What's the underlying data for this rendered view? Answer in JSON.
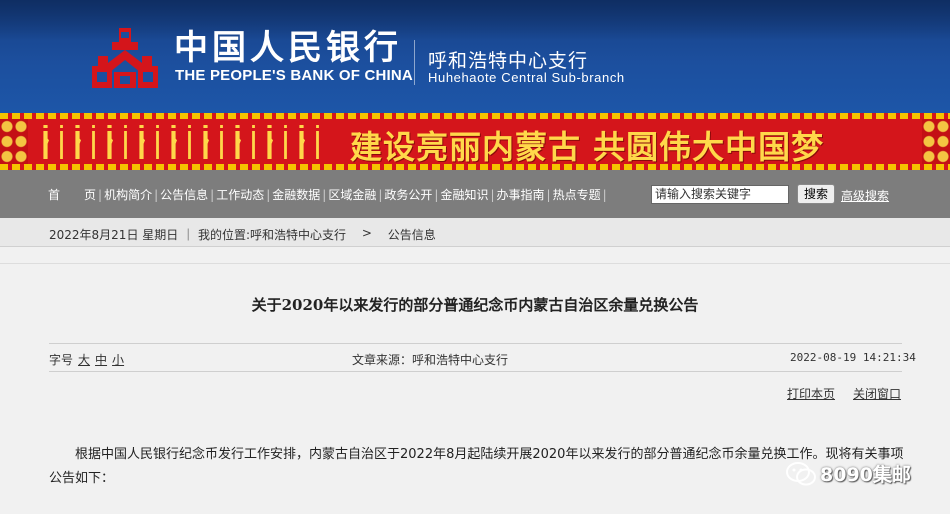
{
  "header": {
    "bank_name_cn": "中国人民银行",
    "bank_name_en": "THE PEOPLE'S BANK OF CHINA",
    "branch_cn": "呼和浩特中心支行",
    "branch_en": "Huhehaote Central Sub-branch",
    "colors": {
      "header_bg": "#1c4f9e",
      "logo_red": "#d4151b"
    }
  },
  "banner": {
    "slogan": "建设亮丽内蒙古  共圆伟大中国梦",
    "colors": {
      "bg": "#d4151b",
      "text": "#ffd84a"
    }
  },
  "nav": {
    "items": [
      "首　　页",
      "机构简介",
      "公告信息",
      "工作动态",
      "金融数据",
      "区域金融",
      "政务公开",
      "金融知识",
      "办事指南",
      "热点专题"
    ],
    "search_placeholder": "请输入搜索关键字",
    "search_button": "搜索",
    "advanced_search": "高级搜索"
  },
  "breadcrumb": {
    "date": "2022年8月21日",
    "weekday": "星期日",
    "location_label": "我的位置:",
    "path": [
      "呼和浩特中心支行",
      "公告信息"
    ],
    "separator": ">"
  },
  "article": {
    "title": "关于2020年以来发行的部分普通纪念币内蒙古自治区余量兑换公告",
    "font_size_label": "字号",
    "font_sizes": [
      "大",
      "中",
      "小"
    ],
    "source": "文章来源：呼和浩特中心支行",
    "datetime": "2022-08-19 14:21:34",
    "print_label": "打印本页",
    "close_label": "关闭窗口",
    "body": "根据中国人民银行纪念币发行工作安排，内蒙古自治区于2022年8月起陆续开展2020年以来发行的部分普通纪念币余量兑换工作。现将有关事项公告如下："
  },
  "watermark": {
    "icon": "wechat-icon",
    "text": "8090集邮"
  }
}
